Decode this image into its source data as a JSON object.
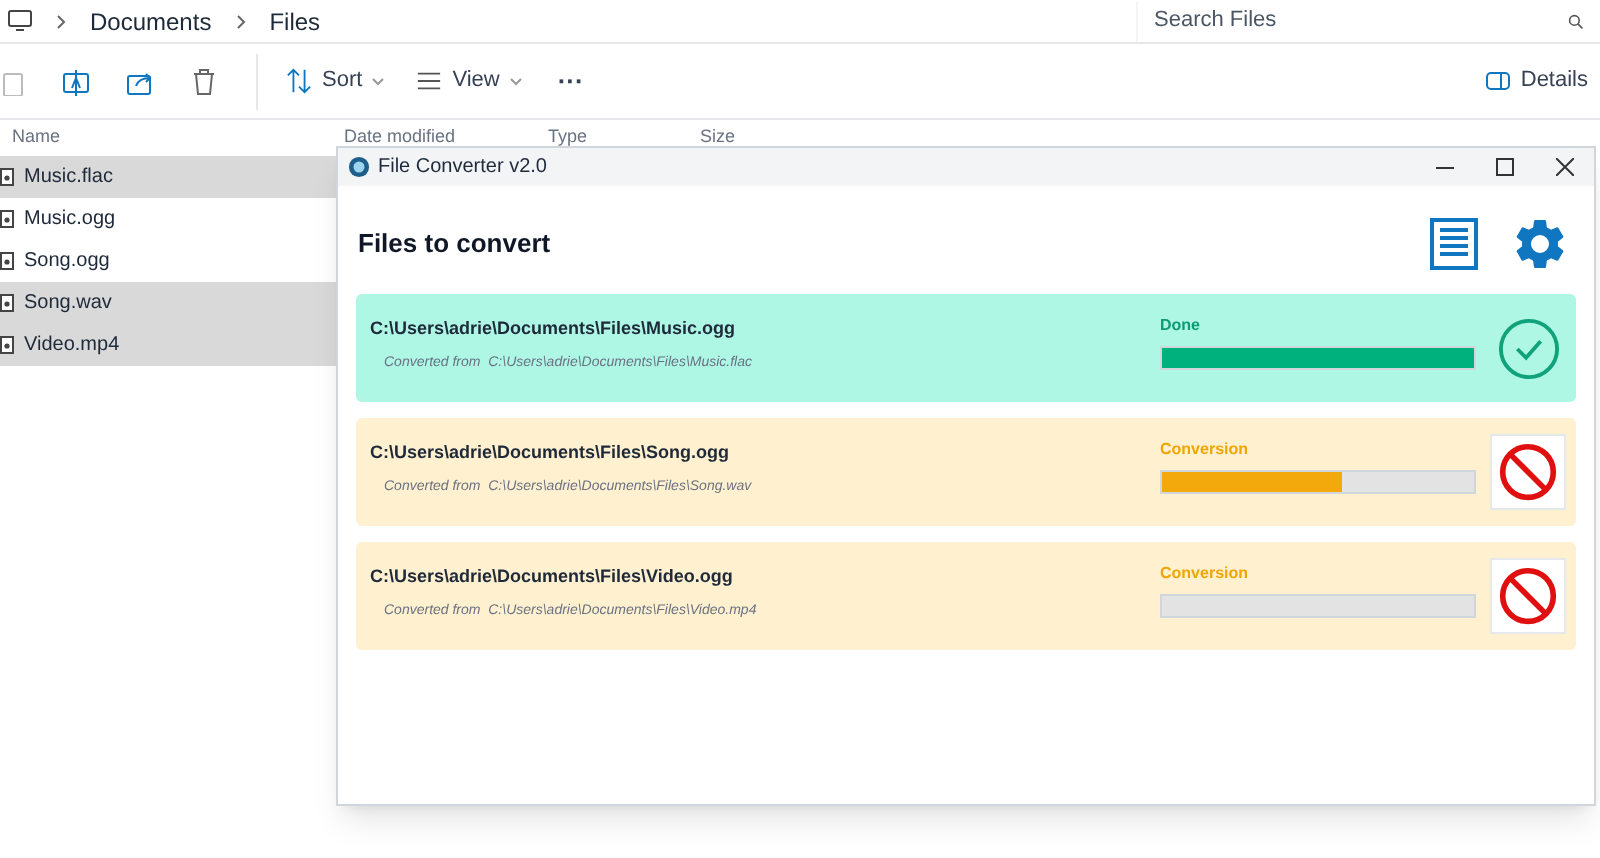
{
  "explorer": {
    "breadcrumbs": [
      "Documents",
      "Files"
    ],
    "search": {
      "placeholder": "Search Files"
    },
    "toolbar": [
      {
        "kind": "icon"
      },
      {
        "kind": "icon"
      },
      {
        "kind": "icon"
      },
      {
        "kind": "icon"
      },
      {
        "kind": "menu",
        "label": "Sort"
      },
      {
        "kind": "menu",
        "label": "View"
      },
      {
        "kind": "more",
        "label": "···"
      }
    ],
    "details_label": "Details",
    "columns": [
      "Name",
      "Date modified",
      "Type",
      "Size"
    ],
    "files": [
      {
        "name": "Music.flac",
        "selected": true
      },
      {
        "name": "Music.ogg",
        "selected": false
      },
      {
        "name": "Song.ogg",
        "selected": false
      },
      {
        "name": "Song.wav",
        "selected": true
      },
      {
        "name": "Video.mp4",
        "selected": true
      }
    ]
  },
  "converter": {
    "window": {
      "title": "File Converter v2.0"
    },
    "heading": "Files to convert",
    "jobs": [
      {
        "output": "C:\\Users\\adrie\\Documents\\Files\\Music.ogg",
        "source": "Converted from  C:\\Users\\adrie\\Documents\\Files\\Music.flac",
        "status": "Done",
        "kind": "done",
        "level": 1
      },
      {
        "output": "C:\\Users\\adrie\\Documents\\Files\\Song.ogg",
        "source": "Converted from  C:\\Users\\adrie\\Documents\\Files\\Song.wav",
        "status": "Conversion",
        "kind": "converting",
        "level": 0.58
      },
      {
        "output": "C:\\Users\\adrie\\Documents\\Files\\Video.ogg",
        "source": "Converted from  C:\\Users\\adrie\\Documents\\Files\\Video.mp4",
        "status": "Conversion",
        "kind": "converting",
        "level": 0
      }
    ]
  }
}
